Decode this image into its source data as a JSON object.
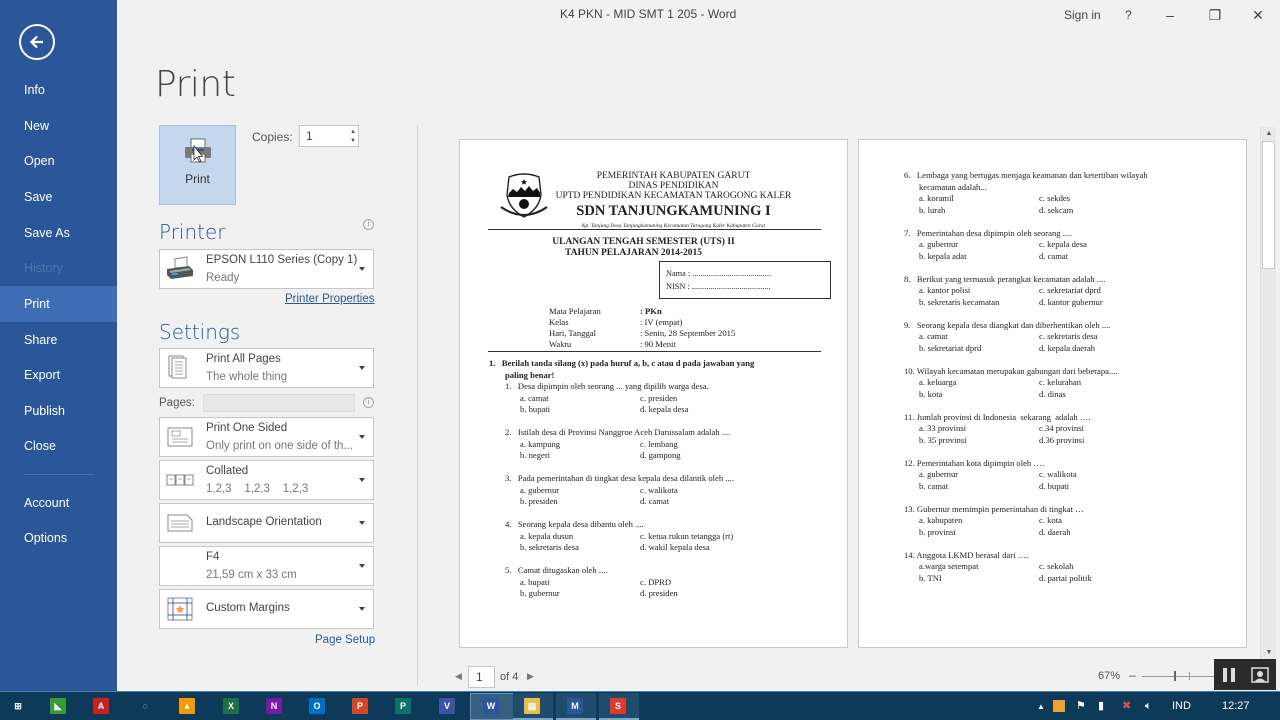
{
  "window": {
    "title": "K4 PKN - MID SMT 1 205 - Word",
    "sign_in": "Sign in",
    "help": "?",
    "minimize": "–",
    "restore": "❐",
    "close": "✕"
  },
  "sidebar": {
    "back_icon": "back-arrow-icon",
    "items": [
      {
        "label": "Info"
      },
      {
        "label": "New"
      },
      {
        "label": "Open"
      },
      {
        "label": "Save"
      },
      {
        "label": "Save As"
      },
      {
        "label": "History",
        "disabled": true
      },
      {
        "label": "Print",
        "active": true
      },
      {
        "label": "Share"
      },
      {
        "label": "Export"
      },
      {
        "label": "Publish"
      },
      {
        "label": "Close"
      },
      {
        "label": "Account"
      },
      {
        "label": "Options"
      }
    ]
  },
  "print": {
    "heading": "Print",
    "print_button": "Print",
    "copies_label": "Copies:",
    "copies_value": "1",
    "printer_heading": "Printer",
    "printer_name": "EPSON L110 Series (Copy 1)",
    "printer_status": "Ready",
    "printer_properties": "Printer Properties",
    "settings_heading": "Settings",
    "settings": [
      {
        "title": "Print All Pages",
        "subtitle": "The whole thing",
        "icon": "pages-icon"
      },
      {
        "title": "Print One Sided",
        "subtitle": "Only print on one side of th...",
        "icon": "one-sided-icon"
      },
      {
        "title": "Collated",
        "subtitle": "1,2,3    1,2,3    1,2,3",
        "icon": "collated-icon"
      },
      {
        "title": "Landscape Orientation",
        "subtitle": "",
        "icon": "orientation-icon"
      },
      {
        "title": "F4",
        "subtitle": "21,59 cm x 33 cm",
        "icon": "paper-size-icon"
      },
      {
        "title": "Custom Margins",
        "subtitle": "",
        "icon": "margins-icon"
      }
    ],
    "pages_label": "Pages:",
    "pages_value": "",
    "page_setup": "Page Setup"
  },
  "preview": {
    "page1": {
      "header": [
        "PEMERINTAH KABUPATEN GARUT",
        "DINAS PENDIDIKAN",
        "UPTD PENDIDIKAN KECAMATAN TAROGONG KALER"
      ],
      "school": "SDN TANJUNGKAMUNING I",
      "address": "Kp. Tanjung Desa Tanjungkamuning Kecamatan Tarogong Kaler Kabupaten Garut",
      "exam_title": "ULANGAN TENGAH SEMESTER (UTS) II",
      "exam_year": "TAHUN PELAJARAN 2014-2015",
      "name_label": "Nama   : ......................................",
      "nisn_label": "NISN   : ......................................",
      "info": [
        {
          "k": "Mata Pelajaran",
          "v": ": PKn"
        },
        {
          "k": "Kelas",
          "v": ": IV (empat)"
        },
        {
          "k": "Hari, Tanggal",
          "v": ": Senin, 28 September 2015"
        },
        {
          "k": "Waktu",
          "v": ": 90 Menit"
        }
      ],
      "instruction_line1": "1.   Berilah tanda silang (x) pada huruf a, b, c atau d pada jawaban yang",
      "instruction_line2": "paling benar!",
      "questions": [
        {
          "q": "1.   Desa dipimpin oleh seorang ... yang dipilih warga desa.",
          "a": "a. camat",
          "b": "b. bupati",
          "c": "c. presiden",
          "d": "d. kepala desa"
        },
        {
          "q": "2.   Istilah desa di Provinsi Nanggroe Aceh Darussalam adalah ....",
          "a": "a. kampung",
          "b": "b. negeri",
          "c": "c. lembang",
          "d": "d. gampong"
        },
        {
          "q": "3.   Pada pemerintahan di tingkat desa kepala desa dilantik oleh ....",
          "a": "a. gubernur",
          "b": "b. presiden",
          "c": "c. walikota",
          "d": "d. camat"
        },
        {
          "q": "4.   Seorang kepala desa dibantu oleh ....",
          "a": "a. kepala dusun",
          "b": "b. sekretaris desa",
          "c": "c. ketua rukun tetangga (rt)",
          "d": "d. wakil kepala desa"
        },
        {
          "q": "5.   Camat ditugaskan oleh ....",
          "a": "a. bupati",
          "b": "b. gubernur",
          "c": "c. DPRD",
          "d": "d. presiden"
        }
      ]
    },
    "page2": {
      "questions": [
        {
          "q": "6.   Lembaga yang bertugas menjaga keamanan dan ketertiban wilayah",
          "q2": "kecamatan adalah...",
          "a": "a. koramil",
          "b": "b. lurah",
          "c": "c. sekdes",
          "d": "d. sekcam"
        },
        {
          "q": "7.   Pemerintahan desa dipimpin oleh seorang ....",
          "a": "a. gubernur",
          "b": "b. kepala adat",
          "c": "c. kepala desa",
          "d": "d. camat"
        },
        {
          "q": "8.   Berikut yang termasuk perangkat kecamatan adalah ....",
          "a": "a. kantor polisi",
          "b": "b. sekretaris kecamatan",
          "c": "c. sekretariat dprd",
          "d": "d. kantor gubernur"
        },
        {
          "q": "9.   Seorang kepala desa diangkat dan diberhentikan oleh ....",
          "a": "a. camat",
          "b": "b. sekretariat dprd",
          "c": "c. sekretaris desa",
          "d": "d. kepala daerah"
        },
        {
          "q": "10. Wilayah kecamatan merupakan gabungan dari beberapa....",
          "a": "a. keluarga",
          "b": "b. kota",
          "c": "c. kelurahan",
          "d": "d. dinas"
        },
        {
          "q": "11. Jumlah provinsi di Indonesia  sekarang  adalah ….",
          "a": "a. 33 provinsi",
          "b": "b. 35 provinsi",
          "c": "c.34 provinsi",
          "d": "d.36 provinsi"
        },
        {
          "q": "12. Pemerintahan kota dipimpin oleh ….",
          "a": "a. gubernur",
          "b": "b. camat",
          "c": "c. walikota",
          "d": "d. bupati"
        },
        {
          "q": "13. Gubernur memimpin pemerintahan di tingkat …",
          "a": "a. kabupaten",
          "b": "b. provinsi",
          "c": "c. kota",
          "d": "d. daerah"
        },
        {
          "q": "14. Anggota LKMD berasal dari ….",
          "a": "a.warga setempat",
          "b": "b. TNI",
          "c": "c. sekolah",
          "d": "d. partai politik"
        }
      ]
    },
    "current_page": "1",
    "of_pages": "of 4",
    "zoom_percent": "67%",
    "zoom_level": 0.67
  },
  "taskbar": {
    "apps": [
      {
        "name": "start",
        "label": "⊞",
        "color": "#0e3a5a"
      },
      {
        "name": "corel",
        "label": "◣",
        "color": "#3a9a3a"
      },
      {
        "name": "acrobat",
        "label": "A",
        "color": "#c8201e"
      },
      {
        "name": "chrome-like",
        "label": "◌",
        "color": "#0e3a5a"
      },
      {
        "name": "avast",
        "label": "▲",
        "color": "#f59b00"
      },
      {
        "name": "excel",
        "label": "X",
        "color": "#1e7145"
      },
      {
        "name": "onenote",
        "label": "N",
        "color": "#7719aa"
      },
      {
        "name": "outlook",
        "label": "O",
        "color": "#0072c6"
      },
      {
        "name": "powerpoint",
        "label": "P",
        "color": "#d24726"
      },
      {
        "name": "publisher",
        "label": "P",
        "color": "#077568"
      },
      {
        "name": "visio",
        "label": "V",
        "color": "#3955a3"
      },
      {
        "name": "word",
        "label": "W",
        "color": "#2b579a"
      },
      {
        "name": "file-explorer",
        "label": "▤",
        "color": "#e8c14d"
      },
      {
        "name": "media-app",
        "label": "M",
        "color": "#2b579a"
      },
      {
        "name": "s-app",
        "label": "S",
        "color": "#e03a2f"
      }
    ],
    "tray": {
      "language": "IND",
      "time": "12:27"
    }
  }
}
